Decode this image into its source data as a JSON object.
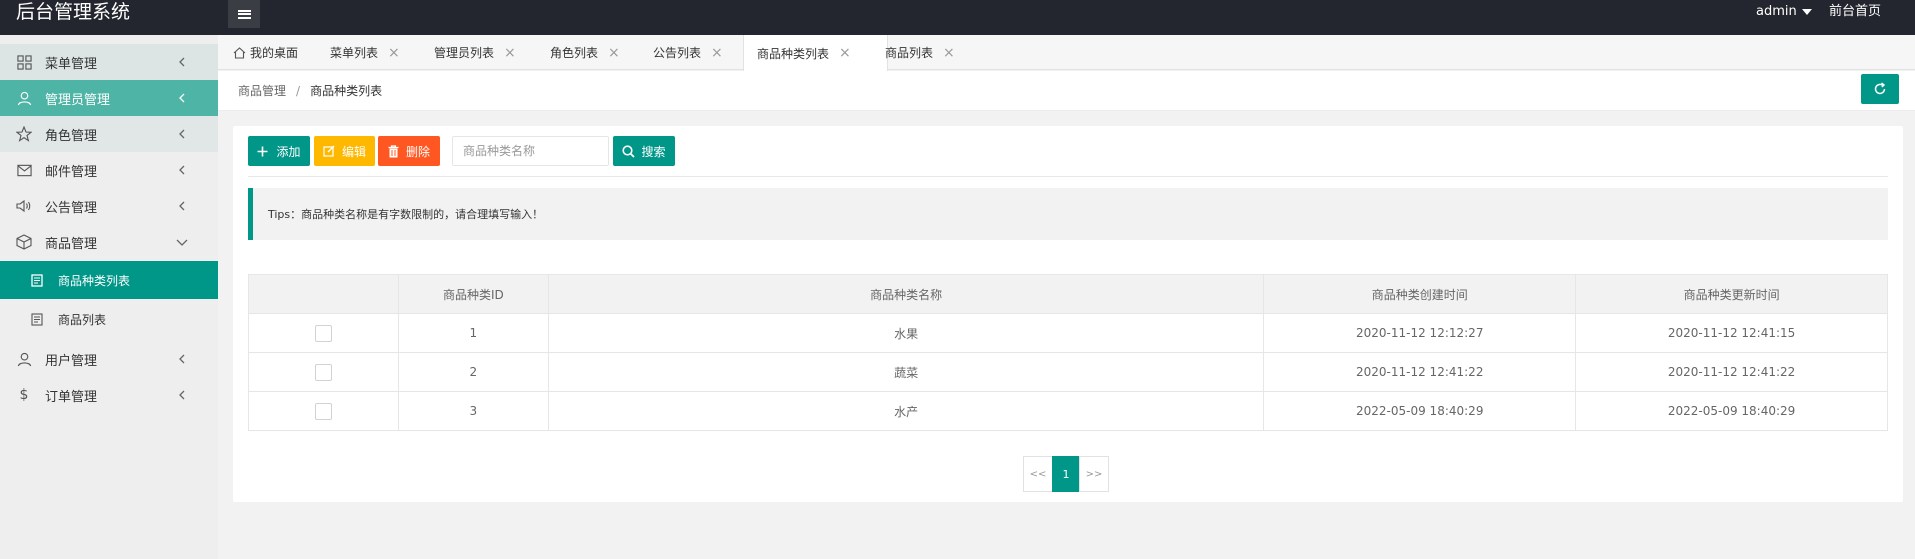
{
  "header": {
    "title": "后台管理系统",
    "user": "admin",
    "front_link": "前台首页"
  },
  "sidebar": {
    "items": [
      {
        "label": "菜单管理",
        "icon": "grid-icon"
      },
      {
        "label": "管理员管理",
        "icon": "user-icon"
      },
      {
        "label": "角色管理",
        "icon": "star-icon"
      },
      {
        "label": "邮件管理",
        "icon": "mail-icon"
      },
      {
        "label": "公告管理",
        "icon": "speaker-icon"
      },
      {
        "label": "商品管理",
        "icon": "box-icon"
      },
      {
        "label": "用户管理",
        "icon": "user-icon"
      },
      {
        "label": "订单管理",
        "icon": "dollar-icon"
      }
    ],
    "subitems": [
      {
        "label": "商品种类列表",
        "icon": "doc-icon",
        "active": true
      },
      {
        "label": "商品列表",
        "icon": "doc-icon",
        "active": false
      }
    ]
  },
  "tabs": [
    {
      "label": "我的桌面",
      "closable": false
    },
    {
      "label": "菜单列表",
      "closable": true
    },
    {
      "label": "管理员列表",
      "closable": true
    },
    {
      "label": "角色列表",
      "closable": true
    },
    {
      "label": "公告列表",
      "closable": true
    },
    {
      "label": "商品种类列表",
      "closable": true,
      "active": true
    },
    {
      "label": "商品列表",
      "closable": true
    }
  ],
  "breadcrumb": {
    "parent": "商品管理",
    "separator": "/",
    "current": "商品种类列表"
  },
  "toolbar": {
    "add_label": "添加",
    "edit_label": "编辑",
    "delete_label": "删除",
    "search_placeholder": "商品种类名称",
    "search_value": "",
    "search_label": "搜索"
  },
  "tips": "Tips：商品种类名称是有字数限制的，请合理填写输入！",
  "table": {
    "columns": [
      "",
      "商品种类ID",
      "商品种类名称",
      "商品种类创建时间",
      "商品种类更新时间"
    ],
    "rows": [
      {
        "id": "1",
        "name": "水果",
        "created": "2020-11-12 12:12:27",
        "updated": "2020-11-12 12:41:15"
      },
      {
        "id": "2",
        "name": "蔬菜",
        "created": "2020-11-12 12:41:22",
        "updated": "2020-11-12 12:41:22"
      },
      {
        "id": "3",
        "name": "水产",
        "created": "2022-05-09 18:40:29",
        "updated": "2022-05-09 18:40:29"
      }
    ]
  },
  "pagination": {
    "prev": "<<",
    "current": "1",
    "next": ">>"
  },
  "colors": {
    "primary": "#009688",
    "warning": "#ffb800",
    "danger": "#ff5722",
    "header_bg": "#23262e"
  }
}
